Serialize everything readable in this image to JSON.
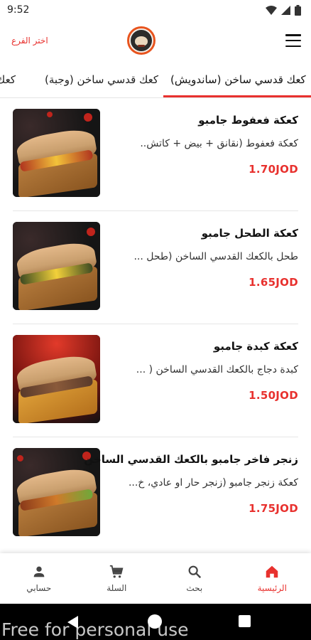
{
  "status_bar": {
    "time": "9:52"
  },
  "header": {
    "branch_label": "اختر الفرع"
  },
  "tabs": [
    {
      "label": "كعك قدسي ساخن (ساندويش)",
      "active": true
    },
    {
      "label": "كعك قدسي ساخن (وجبة)",
      "active": false
    },
    {
      "label": "كعك ا",
      "active": false
    }
  ],
  "products": [
    {
      "title": "كعكة فعفوط جامبو",
      "description": "كعكة فعفوط (نقانق + بيض + كاتش..",
      "price": "1.70JOD"
    },
    {
      "title": "كعكة الطحل جامبو",
      "description": "طحل بالكعك القدسي الساخن (طحل ...",
      "price": "1.65JOD"
    },
    {
      "title": "كعكة كبدة جامبو",
      "description": "كبدة دجاج بالكعك القدسي الساخن ( ...",
      "price": "1.50JOD"
    },
    {
      "title": "زنجر فاخر جامبو بالكعك القدسي الساخن",
      "description": "كعكة زنجر جامبو (زنجر حار او عادي، خ...",
      "price": "1.75JOD"
    }
  ],
  "bottom_nav": {
    "home": "الرئيسية",
    "search": "بحث",
    "cart": "السلة",
    "account": "حسابي"
  },
  "watermark": "Free for personal use",
  "colors": {
    "accent": "#e8312e",
    "logo_ring": "#e8541e"
  },
  "icons": [
    "wifi-icon",
    "signal-icon",
    "battery-icon",
    "menu-icon",
    "home-icon",
    "search-icon",
    "cart-icon",
    "account-icon"
  ]
}
